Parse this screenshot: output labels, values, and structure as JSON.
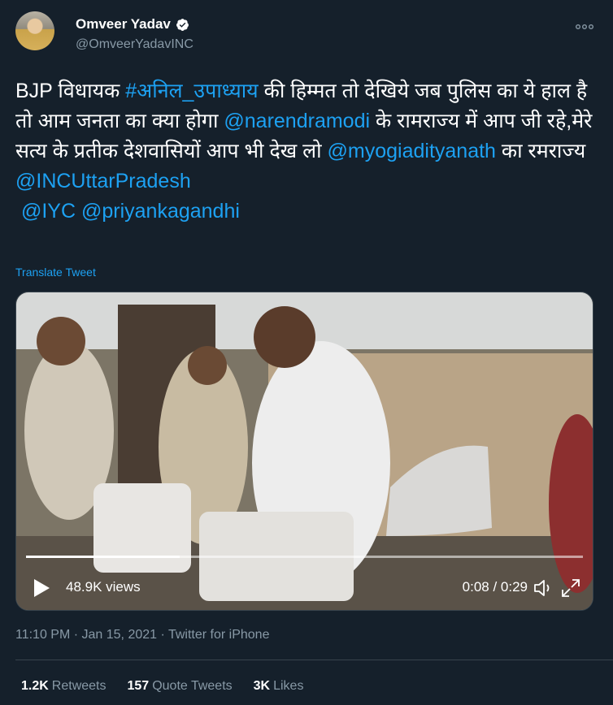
{
  "author": {
    "name": "Omveer Yadav",
    "handle": "@OmveerYadavINC"
  },
  "tweet": {
    "t1": "BJP विधायक ",
    "hashtag": "#अनिल_उपाध्याय",
    "t2": " की हिम्मत तो देखिये जब पुलिस का ये हाल है तो आम जनता का क्या होगा ",
    "mention1": "@narendramodi",
    "t3": " के रामराज्य में आप जी रहे,मेरे सत्य के प्रतीक देशवासियों आप भी देख लो ",
    "mention2": "@myogiadityanath",
    "t4": " का रमराज्य",
    "mention3": "@INCUttarPradesh",
    "mention4": "@IYC",
    "mention5": "@priyankagandhi"
  },
  "translate_label": "Translate Tweet",
  "video": {
    "views": "48.9K views",
    "time": "0:08 / 0:29",
    "progress": 0.276
  },
  "meta": "11:10 PM · Jan 15, 2021 · Twitter for iPhone",
  "stats": {
    "retweets_count": "1.2K",
    "retweets_label": "Retweets",
    "quotes_count": "157",
    "quotes_label": "Quote Tweets",
    "likes_count": "3K",
    "likes_label": "Likes"
  },
  "colors": {
    "background": "#15202b",
    "link": "#1da1f2",
    "secondary_text": "#8899a6"
  },
  "icons": [
    "verified-badge-icon",
    "more-icon",
    "play-icon",
    "volume-icon",
    "fullscreen-icon"
  ]
}
